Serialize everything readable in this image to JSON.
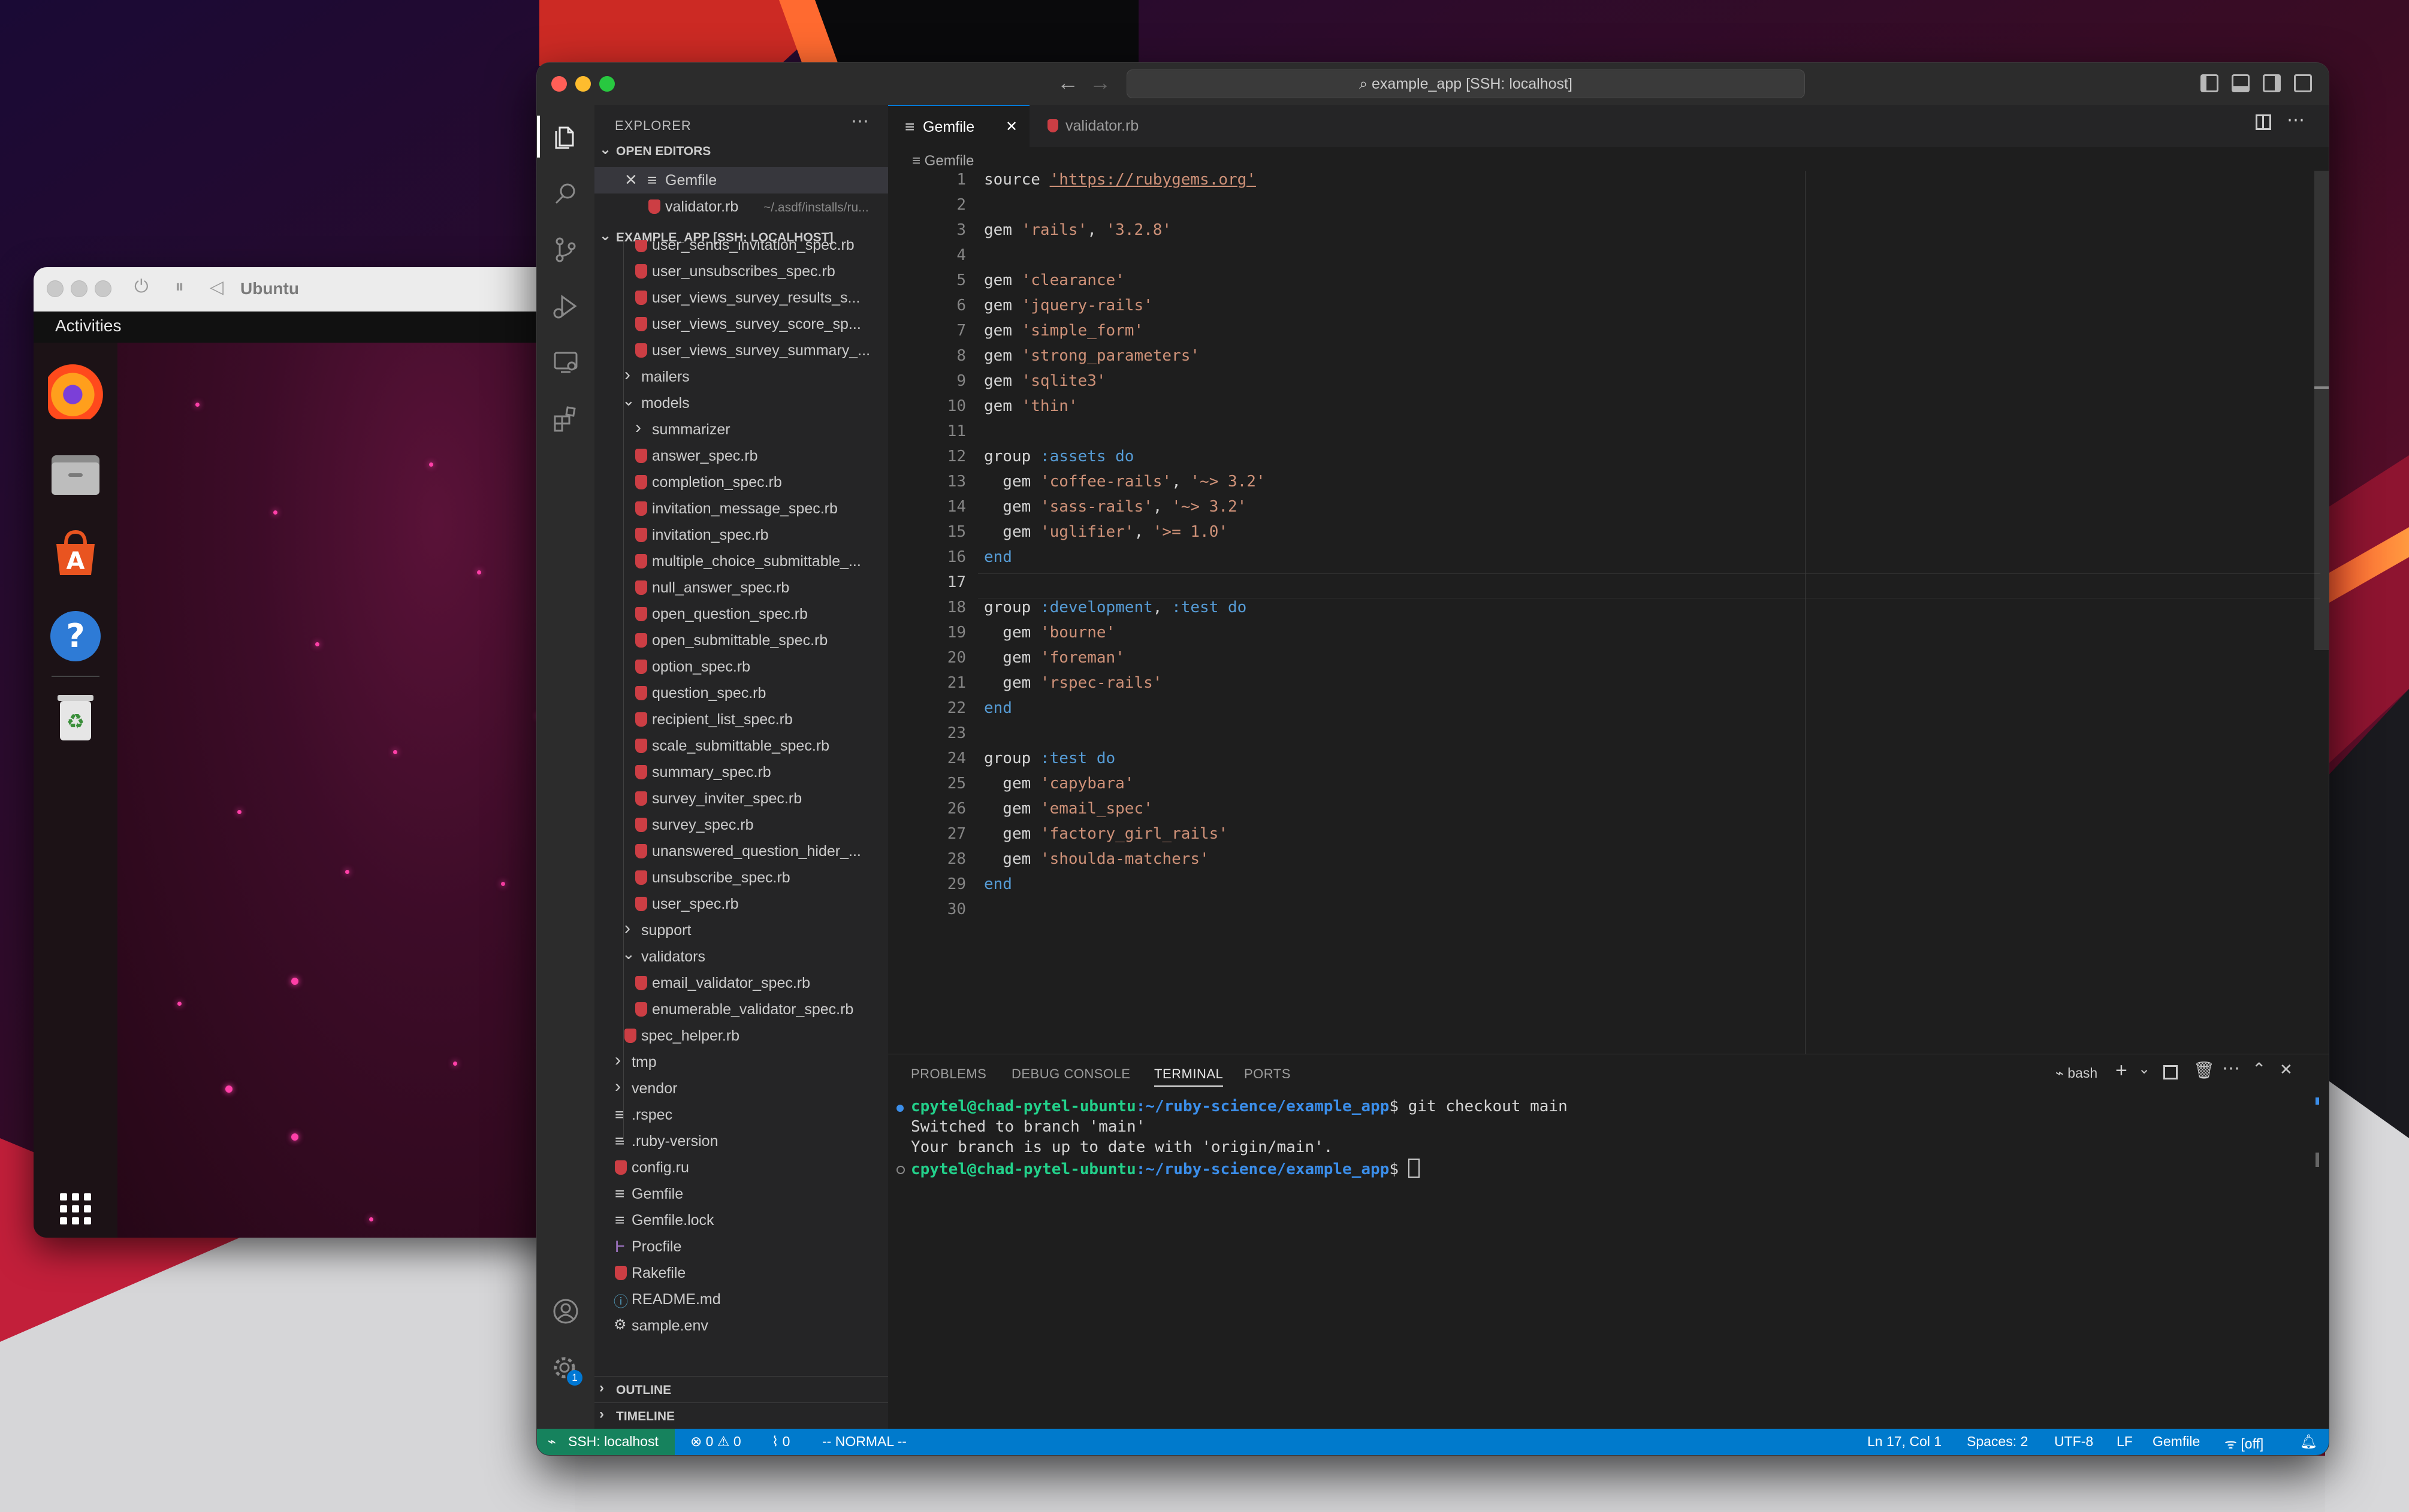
{
  "ubuntu": {
    "title": "Ubuntu",
    "activities": "Activities",
    "dock_icons": [
      "firefox-icon",
      "files-icon",
      "software-icon",
      "help-icon",
      "trash-icon",
      "app-grid-icon"
    ]
  },
  "vscode": {
    "title": "example_app [SSH: localhost]",
    "explorer": {
      "header": "EXPLORER",
      "open_editors": {
        "label": "OPEN EDITORS",
        "items": [
          {
            "name": "Gemfile",
            "path": ""
          },
          {
            "name": "validator.rb",
            "path": "~/.asdf/installs/ru..."
          }
        ]
      },
      "project_label": "EXAMPLE_APP [SSH: LOCALHOST]",
      "tree": [
        {
          "label": "user_sends_invitation_spec.rb",
          "type": "ruby",
          "indent": 2
        },
        {
          "label": "user_unsubscribes_spec.rb",
          "type": "ruby",
          "indent": 2
        },
        {
          "label": "user_views_survey_results_s...",
          "type": "ruby",
          "indent": 2
        },
        {
          "label": "user_views_survey_score_sp...",
          "type": "ruby",
          "indent": 2
        },
        {
          "label": "user_views_survey_summary_...",
          "type": "ruby",
          "indent": 2
        },
        {
          "label": "mailers",
          "type": "folder-closed",
          "indent": 1
        },
        {
          "label": "models",
          "type": "folder-open",
          "indent": 1
        },
        {
          "label": "summarizer",
          "type": "folder-closed",
          "indent": 2
        },
        {
          "label": "answer_spec.rb",
          "type": "ruby",
          "indent": 2
        },
        {
          "label": "completion_spec.rb",
          "type": "ruby",
          "indent": 2
        },
        {
          "label": "invitation_message_spec.rb",
          "type": "ruby",
          "indent": 2
        },
        {
          "label": "invitation_spec.rb",
          "type": "ruby",
          "indent": 2
        },
        {
          "label": "multiple_choice_submittable_...",
          "type": "ruby",
          "indent": 2
        },
        {
          "label": "null_answer_spec.rb",
          "type": "ruby",
          "indent": 2
        },
        {
          "label": "open_question_spec.rb",
          "type": "ruby",
          "indent": 2
        },
        {
          "label": "open_submittable_spec.rb",
          "type": "ruby",
          "indent": 2
        },
        {
          "label": "option_spec.rb",
          "type": "ruby",
          "indent": 2
        },
        {
          "label": "question_spec.rb",
          "type": "ruby",
          "indent": 2
        },
        {
          "label": "recipient_list_spec.rb",
          "type": "ruby",
          "indent": 2
        },
        {
          "label": "scale_submittable_spec.rb",
          "type": "ruby",
          "indent": 2
        },
        {
          "label": "summary_spec.rb",
          "type": "ruby",
          "indent": 2
        },
        {
          "label": "survey_inviter_spec.rb",
          "type": "ruby",
          "indent": 2
        },
        {
          "label": "survey_spec.rb",
          "type": "ruby",
          "indent": 2
        },
        {
          "label": "unanswered_question_hider_...",
          "type": "ruby",
          "indent": 2
        },
        {
          "label": "unsubscribe_spec.rb",
          "type": "ruby",
          "indent": 2
        },
        {
          "label": "user_spec.rb",
          "type": "ruby",
          "indent": 2
        },
        {
          "label": "support",
          "type": "folder-closed",
          "indent": 1
        },
        {
          "label": "validators",
          "type": "folder-open",
          "indent": 1
        },
        {
          "label": "email_validator_spec.rb",
          "type": "ruby",
          "indent": 2
        },
        {
          "label": "enumerable_validator_spec.rb",
          "type": "ruby",
          "indent": 2
        },
        {
          "label": "spec_helper.rb",
          "type": "ruby",
          "indent": 1
        },
        {
          "label": "tmp",
          "type": "folder-closed",
          "indent": 0
        },
        {
          "label": "vendor",
          "type": "folder-closed",
          "indent": 0
        },
        {
          "label": ".rspec",
          "type": "lines",
          "indent": 0
        },
        {
          "label": ".ruby-version",
          "type": "lines",
          "indent": 0
        },
        {
          "label": "config.ru",
          "type": "ruby",
          "indent": 0
        },
        {
          "label": "Gemfile",
          "type": "lines",
          "indent": 0
        },
        {
          "label": "Gemfile.lock",
          "type": "lines",
          "indent": 0
        },
        {
          "label": "Procfile",
          "type": "procfile",
          "indent": 0
        },
        {
          "label": "Rakefile",
          "type": "ruby",
          "indent": 0
        },
        {
          "label": "README.md",
          "type": "info",
          "indent": 0
        },
        {
          "label": "sample.env",
          "type": "gear",
          "indent": 0
        }
      ],
      "outline_label": "OUTLINE",
      "timeline_label": "TIMELINE"
    },
    "tabs": [
      {
        "label": "Gemfile",
        "active": true
      },
      {
        "label": "validator.rb",
        "active": false
      }
    ],
    "breadcrumb": "Gemfile",
    "code": [
      [
        [
          "plain",
          "source "
        ],
        [
          "str",
          "'https://rubygems.org'"
        ]
      ],
      [],
      [
        [
          "plain",
          "gem "
        ],
        [
          "str",
          "'rails'"
        ],
        [
          "plain",
          ", "
        ],
        [
          "str",
          "'3.2.8'"
        ]
      ],
      [],
      [
        [
          "plain",
          "gem "
        ],
        [
          "str",
          "'clearance'"
        ]
      ],
      [
        [
          "plain",
          "gem "
        ],
        [
          "str",
          "'jquery-rails'"
        ]
      ],
      [
        [
          "plain",
          "gem "
        ],
        [
          "str",
          "'simple_form'"
        ]
      ],
      [
        [
          "plain",
          "gem "
        ],
        [
          "str",
          "'strong_parameters'"
        ]
      ],
      [
        [
          "plain",
          "gem "
        ],
        [
          "str",
          "'sqlite3'"
        ]
      ],
      [
        [
          "plain",
          "gem "
        ],
        [
          "str",
          "'thin'"
        ]
      ],
      [],
      [
        [
          "plain",
          "group "
        ],
        [
          "sym",
          ":assets"
        ],
        [
          "plain",
          " "
        ],
        [
          "kw",
          "do"
        ]
      ],
      [
        [
          "plain",
          "  gem "
        ],
        [
          "str",
          "'coffee-rails'"
        ],
        [
          "plain",
          ", "
        ],
        [
          "str",
          "'~> 3.2'"
        ]
      ],
      [
        [
          "plain",
          "  gem "
        ],
        [
          "str",
          "'sass-rails'"
        ],
        [
          "plain",
          ", "
        ],
        [
          "str",
          "'~> 3.2'"
        ]
      ],
      [
        [
          "plain",
          "  gem "
        ],
        [
          "str",
          "'uglifier'"
        ],
        [
          "plain",
          ", "
        ],
        [
          "str",
          "'>= 1.0'"
        ]
      ],
      [
        [
          "kw",
          "end"
        ]
      ],
      [],
      [
        [
          "plain",
          "group "
        ],
        [
          "sym",
          ":development"
        ],
        [
          "plain",
          ", "
        ],
        [
          "sym",
          ":test"
        ],
        [
          "plain",
          " "
        ],
        [
          "kw",
          "do"
        ]
      ],
      [
        [
          "plain",
          "  gem "
        ],
        [
          "str",
          "'bourne'"
        ]
      ],
      [
        [
          "plain",
          "  gem "
        ],
        [
          "str",
          "'foreman'"
        ]
      ],
      [
        [
          "plain",
          "  gem "
        ],
        [
          "str",
          "'rspec-rails'"
        ]
      ],
      [
        [
          "kw",
          "end"
        ]
      ],
      [],
      [
        [
          "plain",
          "group "
        ],
        [
          "sym",
          ":test"
        ],
        [
          "plain",
          " "
        ],
        [
          "kw",
          "do"
        ]
      ],
      [
        [
          "plain",
          "  gem "
        ],
        [
          "str",
          "'capybara'"
        ]
      ],
      [
        [
          "plain",
          "  gem "
        ],
        [
          "str",
          "'email_spec'"
        ]
      ],
      [
        [
          "plain",
          "  gem "
        ],
        [
          "str",
          "'factory_girl_rails'"
        ]
      ],
      [
        [
          "plain",
          "  gem "
        ],
        [
          "str",
          "'shoulda-matchers'"
        ]
      ],
      [
        [
          "kw",
          "end"
        ]
      ],
      []
    ],
    "current_line": 17,
    "panel": {
      "tabs": [
        "PROBLEMS",
        "DEBUG CONSOLE",
        "TERMINAL",
        "PORTS"
      ],
      "active_tab": "TERMINAL",
      "shell": "bash",
      "terminal": {
        "user": "cpytel@chad-pytel-ubuntu",
        "path": ":~/ruby-science/example_app",
        "command": "$ git checkout main",
        "line2": "Switched to branch 'main'",
        "line3": "Your branch is up to date with 'origin/main'.",
        "prompt_end": "$ "
      }
    },
    "status": {
      "remote": "SSH: localhost",
      "errors": "0",
      "warnings": "0",
      "ports": "0",
      "mode": "-- NORMAL --",
      "position": "Ln 17, Col 1",
      "spaces": "Spaces: 2",
      "encoding": "UTF-8",
      "eol": "LF",
      "language": "Gemfile",
      "copilot": "[off]",
      "settings_badge": "1"
    }
  }
}
